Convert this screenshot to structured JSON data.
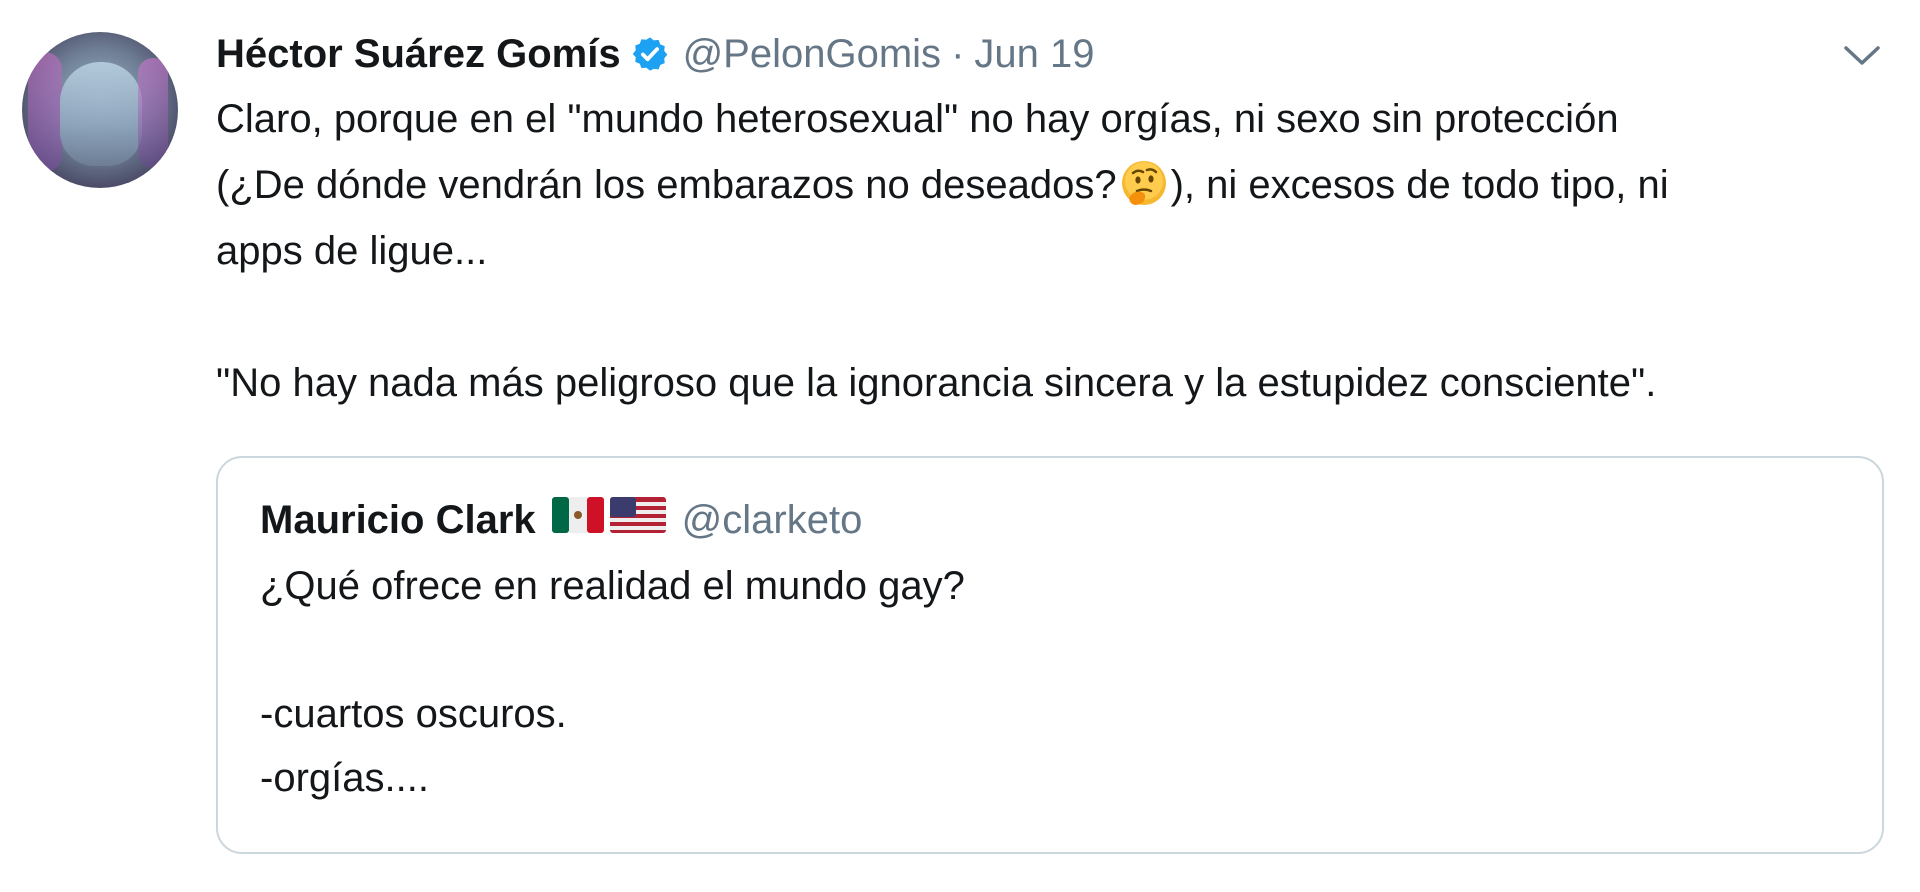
{
  "tweet": {
    "author": {
      "name": "Héctor Suárez Gomís",
      "handle": "@PelonGomis",
      "verified": true
    },
    "separator": "·",
    "date": "Jun 19",
    "text": {
      "line1": "Claro, porque en el \"mundo heterosexual\" no hay orgías, ni sexo sin protección",
      "line2a": "(¿De dónde vendrán los embarazos no deseados?",
      "line2b": "), ni excesos de todo tipo, ni",
      "line3": "apps de ligue...",
      "line4": "\"No hay nada más peligroso que la ignorancia sincera y la estupidez consciente\"."
    },
    "icons": {
      "verified": "verified-badge-icon",
      "menu": "chevron-down-icon",
      "emoji": "thinking-face-emoji",
      "flags": [
        "mexico-flag-icon",
        "usa-flag-icon"
      ]
    },
    "colors": {
      "verified_blue": "#1da1f2",
      "secondary_text": "#657786",
      "border": "#ccd6dd"
    }
  },
  "quoted_tweet": {
    "author": {
      "name": "Mauricio Clark",
      "handle": "@clarketo"
    },
    "text": {
      "line1": "¿Qué ofrece en realidad el mundo gay?",
      "line2": "-cuartos oscuros.",
      "line3": "-orgías...."
    }
  }
}
